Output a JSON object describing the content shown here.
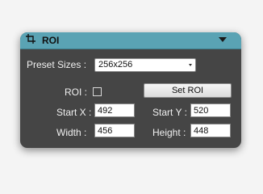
{
  "panel": {
    "title": "ROI",
    "preset_label": "Preset Sizes :",
    "preset_value": "256x256",
    "roi_label": "ROI :",
    "set_roi_label": "Set ROI",
    "start_x_label": "Start X :",
    "start_x_value": "492",
    "start_y_label": "Start Y :",
    "start_y_value": "520",
    "width_label": "Width :",
    "width_value": "456",
    "height_label": "Height :",
    "height_value": "448"
  }
}
